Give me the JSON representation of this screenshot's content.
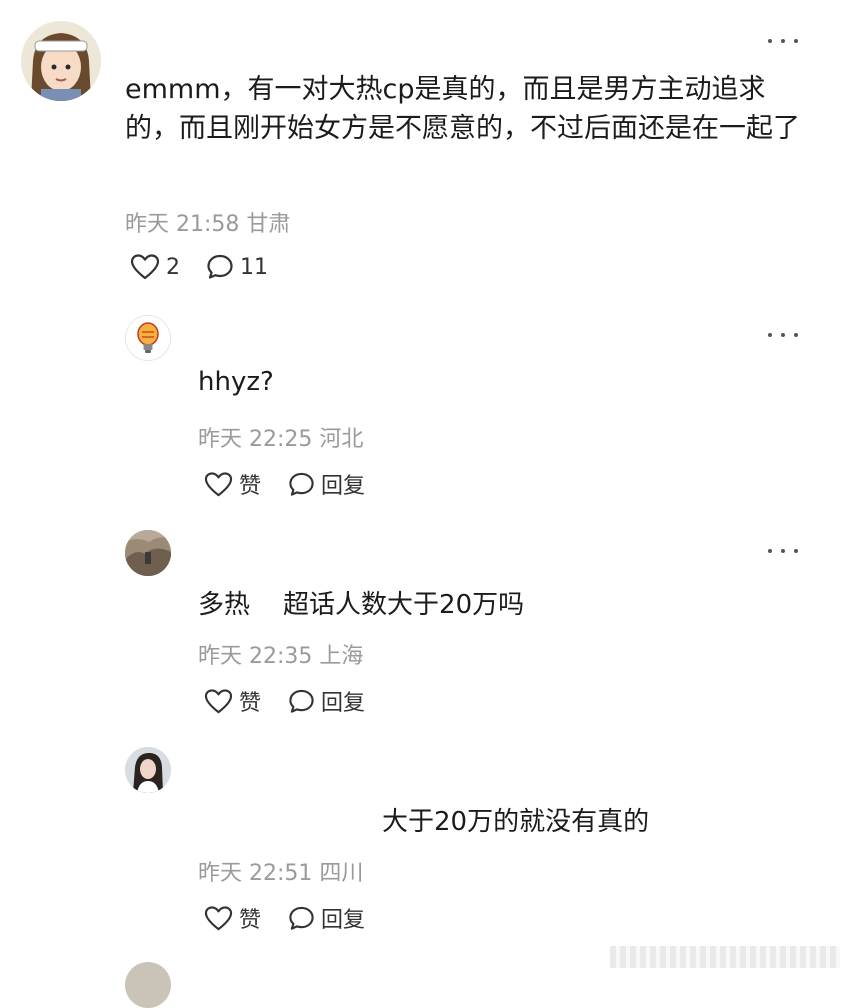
{
  "main_comment": {
    "text": "emmm，有一对大热cp是真的，而且是男方主动追求的，而且刚开始女方是不愿意的，不过后面还是在一起了",
    "time": "昨天 21:58 甘肃",
    "like_count": "2",
    "comment_count": "11",
    "icons": {
      "avatar": "avatar-anime-girl",
      "like": "heart-icon",
      "comment": "comment-bubble-icon",
      "more": "more-dots-icon"
    }
  },
  "replies": [
    {
      "text": "hhyz?",
      "time": "昨天 22:25 河北",
      "like_label": "赞",
      "reply_label": "回复",
      "avatar": "avatar-lightbulb"
    },
    {
      "text": "多热    超话人数大于20万吗",
      "time": "昨天 22:35 上海",
      "like_label": "赞",
      "reply_label": "回复",
      "avatar": "avatar-rocks-photo"
    },
    {
      "text": "大于20万的就没有真的",
      "time": "昨天 22:51 四川",
      "like_label": "赞",
      "reply_label": "回复",
      "avatar": "avatar-girl-photo"
    }
  ],
  "colors": {
    "text": "#1b1b1b",
    "meta": "#9a9a9a",
    "icon": "#333333"
  }
}
